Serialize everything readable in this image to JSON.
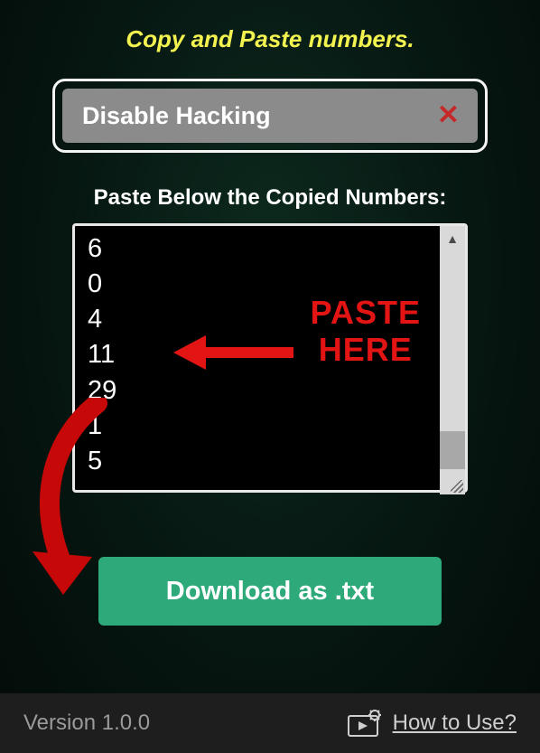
{
  "title": "Copy and Paste numbers.",
  "disable_box": {
    "label": "Disable Hacking",
    "close_glyph": "✕"
  },
  "paste_section": {
    "label": "Paste Below the Copied Numbers:",
    "content": "6\n0\n4\n11\n29\n1\n5",
    "overlay_line1": "PASTE",
    "overlay_line2": "HERE"
  },
  "download_label": "Download as .txt",
  "footer": {
    "version": "Version 1.0.0",
    "how_to_use": "How to Use?"
  }
}
